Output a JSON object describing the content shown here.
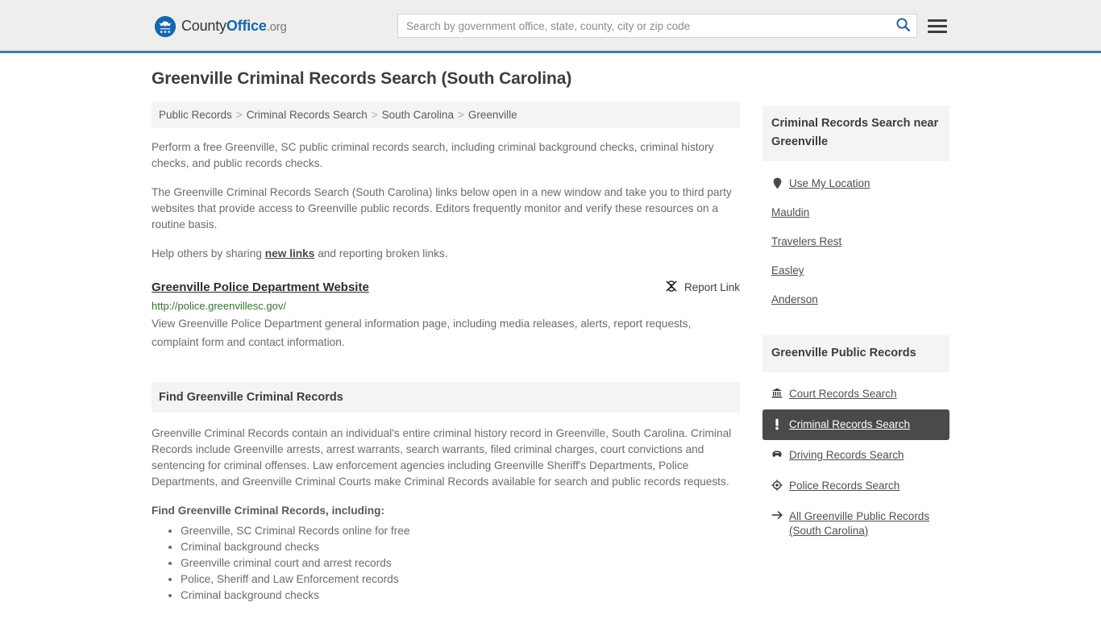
{
  "header": {
    "logo": {
      "part1": "County",
      "part2": "Office",
      "part3": ".org",
      "icon": "eagle-seal-icon"
    },
    "search": {
      "placeholder": "Search by government office, state, county, city or zip code",
      "value": "",
      "icon": "search-icon"
    },
    "menu_icon": "hamburger-menu-icon",
    "accent_color": "#3d7cb0",
    "background_color": "#eeeeec"
  },
  "page": {
    "title": "Greenville Criminal Records Search (South Carolina)"
  },
  "breadcrumb": {
    "separator": ">",
    "items": [
      {
        "label": "Public Records"
      },
      {
        "label": "Criminal Records Search"
      },
      {
        "label": "South Carolina"
      },
      {
        "label": "Greenville"
      }
    ]
  },
  "intro": {
    "p1": "Perform a free Greenville, SC public criminal records search, including criminal background checks, criminal history checks, and public records checks.",
    "p2": "The Greenville Criminal Records Search (South Carolina) links below open in a new window and take you to third party websites that provide access to Greenville public records. Editors frequently monitor and verify these resources on a routine basis.",
    "p3_before": "Help others by sharing ",
    "p3_link": "new links",
    "p3_after": " and reporting broken links."
  },
  "result": {
    "title": "Greenville Police Department Website",
    "url": "http://police.greenvillesc.gov/",
    "description": "View Greenville Police Department general information page, including media releases, alerts, report requests, complaint form and contact information.",
    "report_label": "Report Link",
    "report_icon": "broken-link-icon",
    "url_color": "#35702f"
  },
  "section": {
    "heading": "Find Greenville Criminal Records",
    "paragraph": "Greenville Criminal Records contain an individual's entire criminal history record in Greenville, South Carolina. Criminal Records include Greenville arrests, arrest warrants, search warrants, filed criminal charges, court convictions and sentencing for criminal offenses. Law enforcement agencies including Greenville Sheriff's Departments, Police Departments, and Greenville Criminal Courts make Criminal Records available for search and public records requests.",
    "subheading": "Find Greenville Criminal Records, including:",
    "bullets": [
      "Greenville, SC Criminal Records online for free",
      "Criminal background checks",
      "Greenville criminal court and arrest records",
      "Police, Sheriff and Law Enforcement records",
      "Criminal background checks"
    ]
  },
  "sidebar": {
    "nearby": {
      "heading": "Criminal Records Search near Greenville",
      "items": [
        {
          "label": "Use My Location",
          "icon": "map-pin-icon"
        },
        {
          "label": "Mauldin",
          "icon": null
        },
        {
          "label": "Travelers Rest",
          "icon": null
        },
        {
          "label": "Easley",
          "icon": null
        },
        {
          "label": "Anderson",
          "icon": null
        }
      ]
    },
    "public_records": {
      "heading": "Greenville Public Records",
      "active_background": "#4a4a4a",
      "items": [
        {
          "label": "Court Records Search",
          "icon": "courthouse-icon",
          "active": false
        },
        {
          "label": "Criminal Records Search",
          "icon": "exclamation-icon",
          "active": true
        },
        {
          "label": "Driving Records Search",
          "icon": "car-icon",
          "active": false
        },
        {
          "label": "Police Records Search",
          "icon": "police-badge-icon",
          "active": false
        },
        {
          "label": "All Greenville Public Records (South Carolina)",
          "icon": "arrow-right-icon",
          "active": false
        }
      ]
    }
  }
}
